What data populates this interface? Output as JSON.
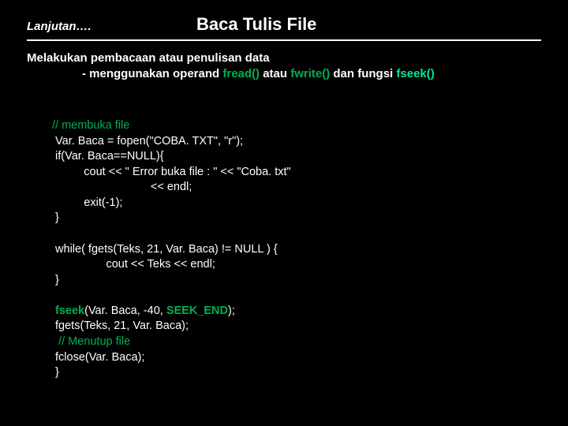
{
  "header": {
    "cont": "Lanjutan…. ",
    "title": "Baca Tulis File"
  },
  "intro": {
    "line1": "Melakukan pembacaan atau penulisan data",
    "line2_pre": "- menggunakan operand ",
    "fread": "fread()",
    "mid1": " atau ",
    "fwrite": "fwrite()",
    "mid2": " dan fungsi ",
    "fseek": "fseek()"
  },
  "code": {
    "c01": "// membuka file",
    "c02": " Var. Baca = fopen(\"COBA. TXT\", \"r\");",
    "c03": " if(Var. Baca==NULL){",
    "c04": "          cout << \" Error buka file : \" << \"Coba. txt\"",
    "c05": "                               << endl;",
    "c06": "          exit(-1);",
    "c07": " }",
    "c08": "",
    "c09": " while( fgets(Teks, 21, Var. Baca) != NULL ) {",
    "c10": "                 cout << Teks << endl;",
    "c11": " }",
    "c12": "",
    "c13a": " ",
    "c13_fseek": "fseek",
    "c13b": "(Var. Baca, -40, ",
    "c13_seekend": "SEEK_END",
    "c13c": ");",
    "c14": " fgets(Teks, 21, Var. Baca);",
    "c15": "  // Menutup file",
    "c16": " fclose(Var. Baca);",
    "c17": " }"
  }
}
